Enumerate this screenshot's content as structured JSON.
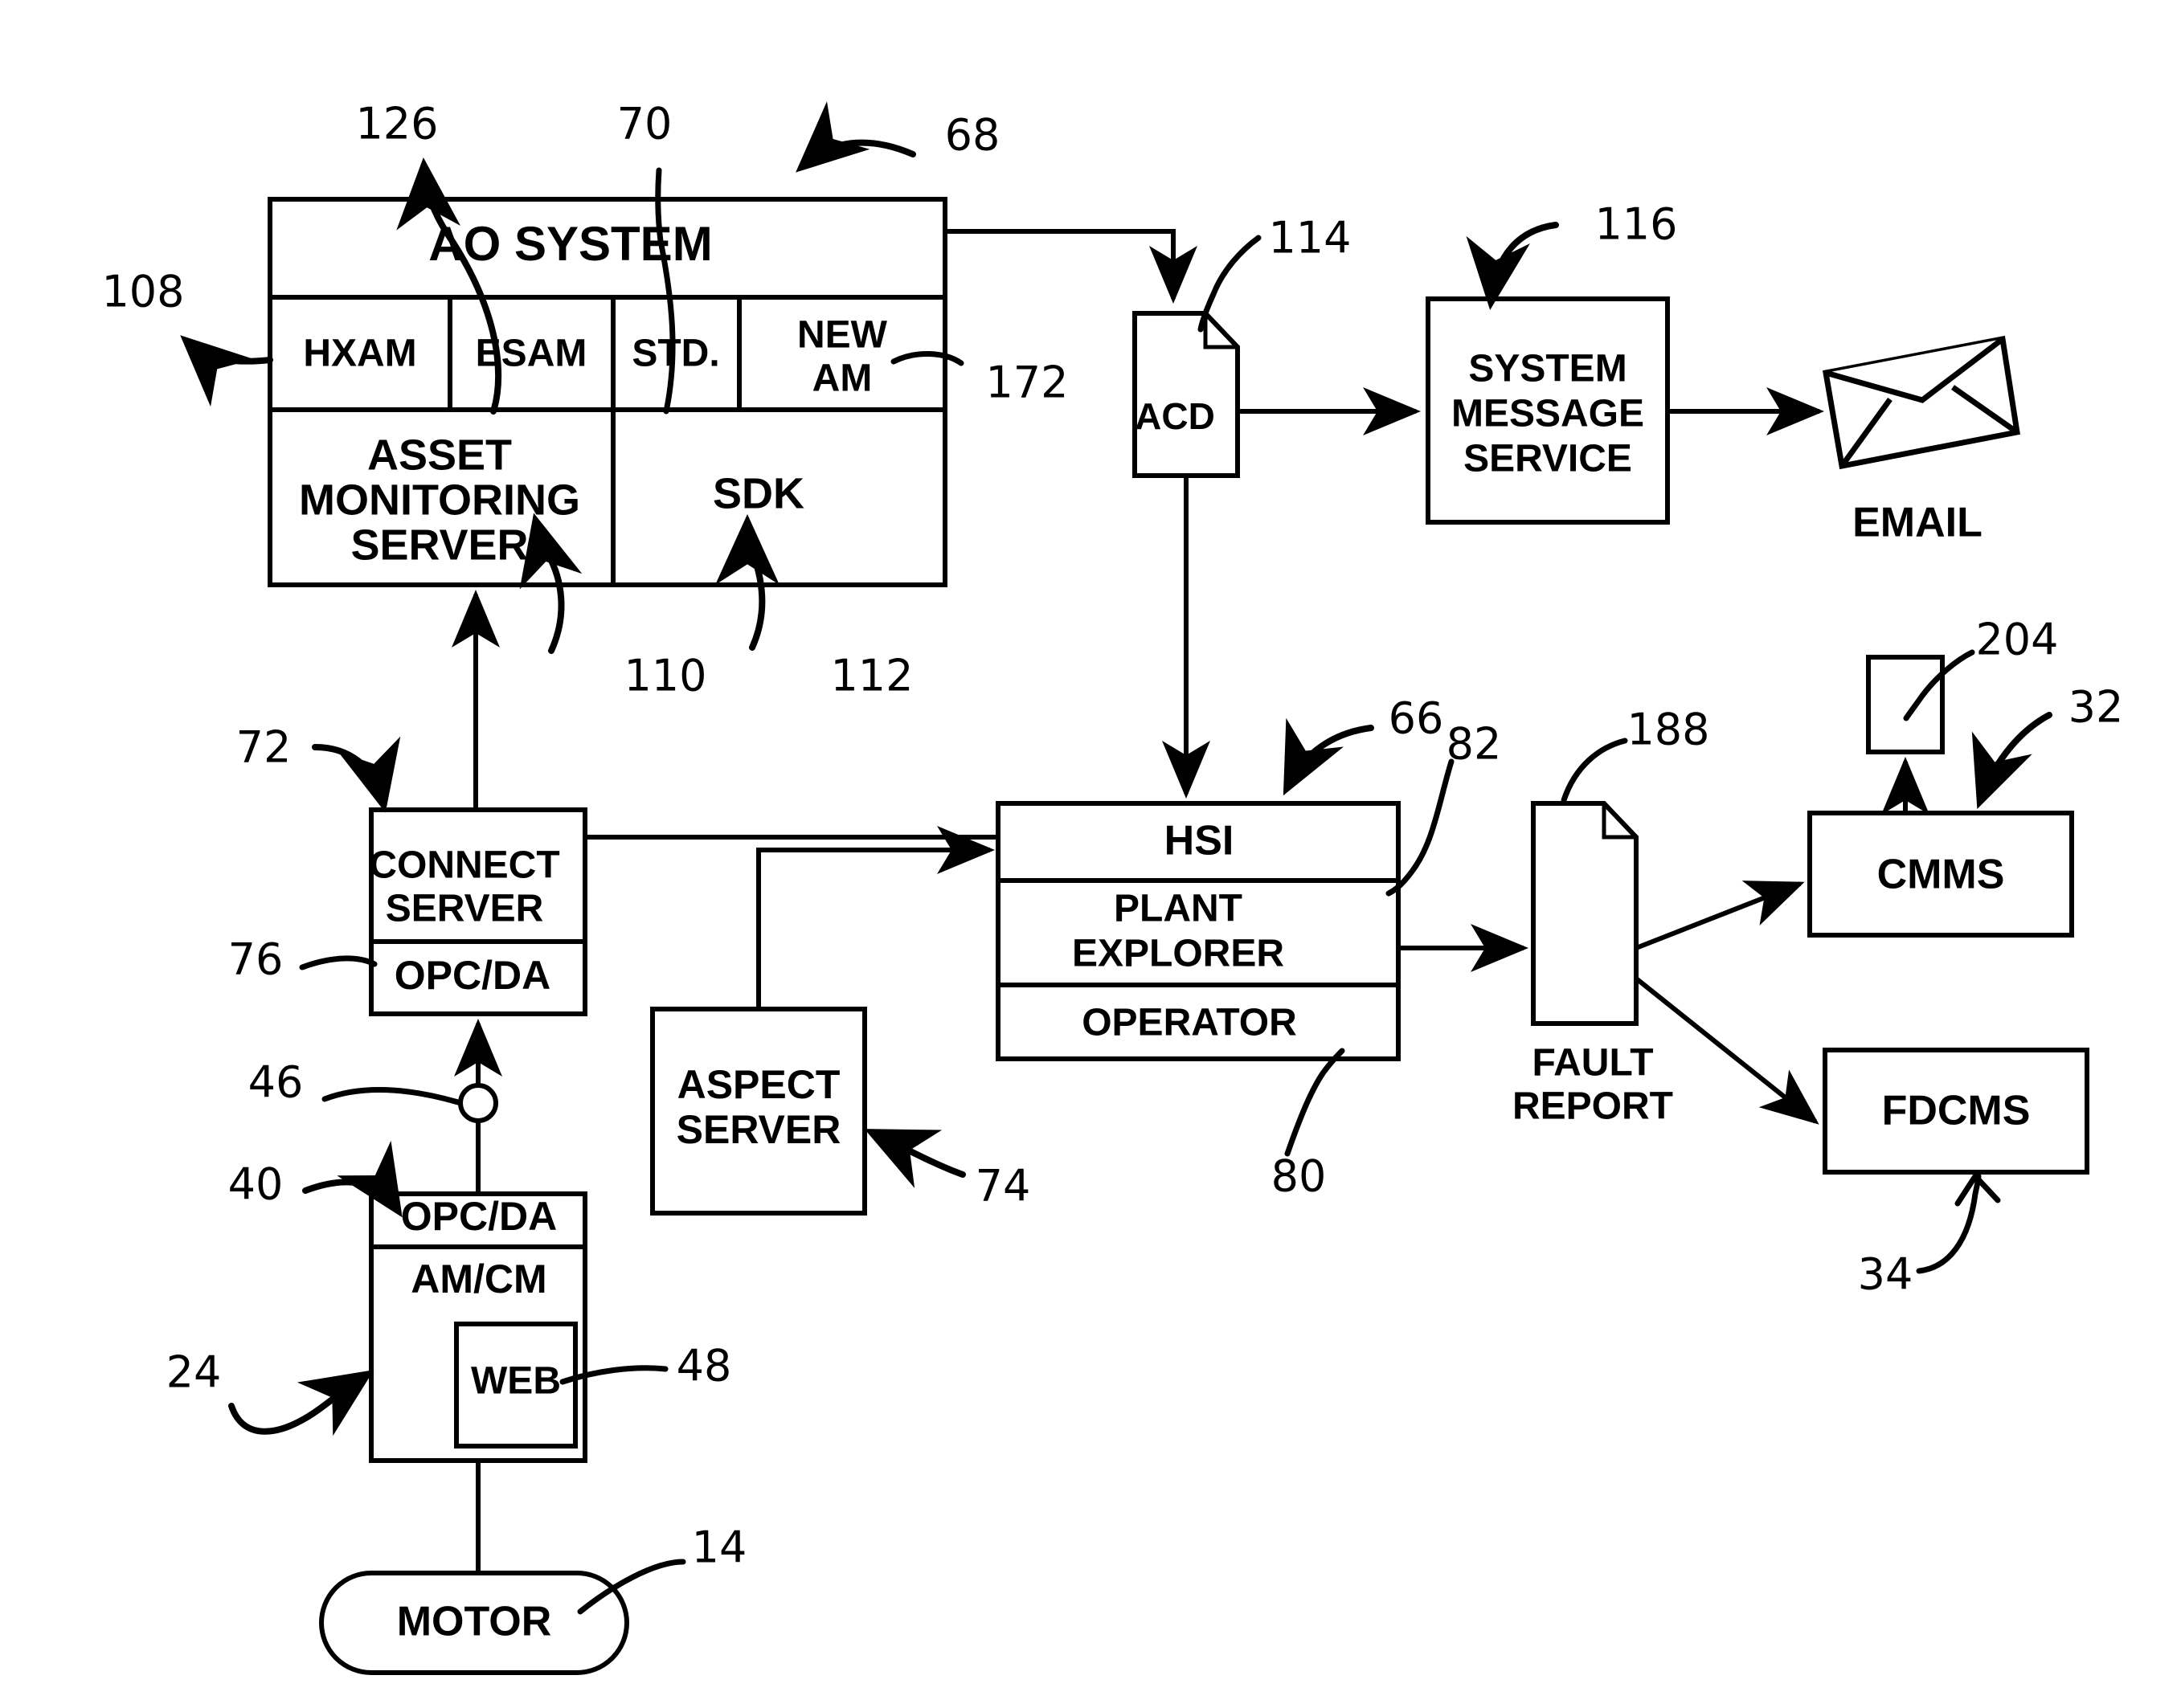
{
  "figure": {
    "title": "Asset Optimization System Block Diagram",
    "domain": "patent-figure"
  },
  "blocks": {
    "ao_system": "AO SYSTEM",
    "hxam": "HXAM",
    "esam": "ESAM",
    "std": "STD.",
    "new_am": "NEW\nAM",
    "new_am_line1": "NEW",
    "new_am_line2": "AM",
    "asset_monitoring_server_line1": "ASSET",
    "asset_monitoring_server_line2": "MONITORING",
    "asset_monitoring_server_line3": "SERVER",
    "sdk": "SDK",
    "acd": "ACD",
    "system_message_service_line1": "SYSTEM",
    "system_message_service_line2": "MESSAGE",
    "system_message_service_line3": "SERVICE",
    "email": "EMAIL",
    "connect_server_line1": "CONNECT",
    "connect_server_line2": "SERVER",
    "opc_da_upper": "OPC/DA",
    "opc_da_lower": "OPC/DA",
    "am_cm": "AM/CM",
    "web": "WEB",
    "motor": "MOTOR",
    "aspect_server_line1": "ASPECT",
    "aspect_server_line2": "SERVER",
    "hsi": "HSI",
    "plant_explorer_line1": "PLANT",
    "plant_explorer_line2": "EXPLORER",
    "operator": "OPERATOR",
    "fault_report_line1": "FAULT",
    "fault_report_line2": "REPORT",
    "cmms": "CMMS",
    "fdcms": "FDCMS"
  },
  "reference_numerals": {
    "n126": "126",
    "n70": "70",
    "n68": "68",
    "n108": "108",
    "n172": "172",
    "n110": "110",
    "n112": "112",
    "n114": "114",
    "n116": "116",
    "n72": "72",
    "n76": "76",
    "n46": "46",
    "n40": "40",
    "n24": "24",
    "n48": "48",
    "n14": "14",
    "n74": "74",
    "n66": "66",
    "n82": "82",
    "n80": "80",
    "n188": "188",
    "n204": "204",
    "n32": "32",
    "n34": "34"
  },
  "colors": {
    "stroke": "#000000",
    "background": "#ffffff"
  }
}
